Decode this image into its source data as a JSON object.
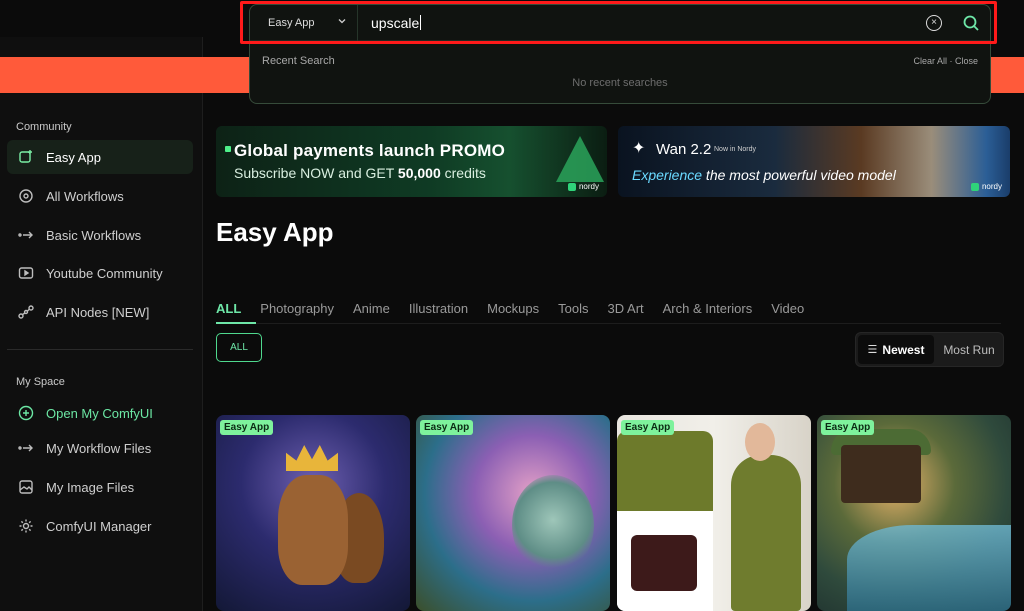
{
  "search": {
    "scope_label": "Easy App",
    "query": "upscale",
    "recent_label": "Recent Search",
    "recent_actions": "Clear All · Close",
    "empty_text": "No recent searches"
  },
  "sidebar": {
    "community_heading": "Community",
    "items": [
      {
        "label": "Easy App"
      },
      {
        "label": "All Workflows"
      },
      {
        "label": "Basic Workflows"
      },
      {
        "label": "Youtube Community"
      },
      {
        "label": "API Nodes [NEW]"
      }
    ],
    "myspace_heading": "My Space",
    "myspace_items": [
      {
        "label": "Open My ComfyUI"
      },
      {
        "label": "My Workflow Files"
      },
      {
        "label": "My Image Files"
      },
      {
        "label": "ComfyUI Manager"
      }
    ]
  },
  "banners": [
    {
      "title": "Global payments launch PROMO",
      "sub_pre": "Subscribe NOW and GET ",
      "sub_bold": "50,000",
      "sub_post": " credits",
      "brand": "nordy"
    },
    {
      "title": "Wan 2.2",
      "small": "Now in Nordy",
      "sub_hl": "Experience",
      "sub_rest": " the most powerful video model",
      "brand": "nordy"
    }
  ],
  "main": {
    "title": "Easy App",
    "tabs": [
      "ALL",
      "Photography",
      "Anime",
      "Illustration",
      "Mockups",
      "Tools",
      "3D Art",
      "Arch & Interiors",
      "Video"
    ],
    "filter_pill": "ALL",
    "sort": {
      "newest": "Newest",
      "most_run": "Most Run"
    },
    "cards": [
      {
        "badge": "Easy App"
      },
      {
        "badge": "Easy App"
      },
      {
        "badge": "Easy App"
      },
      {
        "badge": "Easy App"
      }
    ]
  },
  "colors": {
    "accent": "#6ee7a8",
    "orange": "#ff5a3a",
    "highlight": "#ff1a1a"
  }
}
